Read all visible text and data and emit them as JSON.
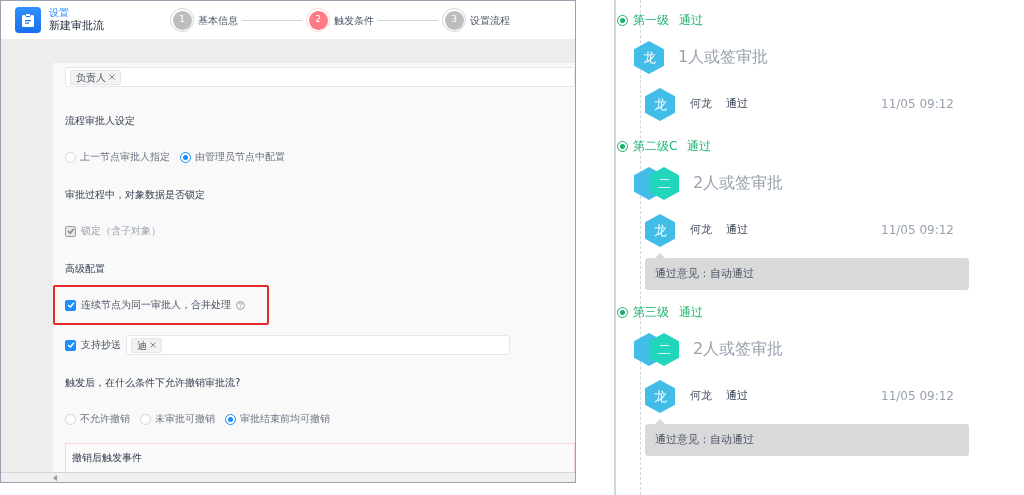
{
  "editor": {
    "breadcrumb": "设置",
    "title": "新建审批流",
    "steps": [
      {
        "number": "1",
        "label": "基本信息",
        "selected": false
      },
      {
        "number": "2",
        "label": "触发条件",
        "selected": true
      },
      {
        "number": "3",
        "label": "设置流程",
        "selected": false
      }
    ],
    "form": [
      {
        "kind": "tag_field",
        "tags": [
          "负责人"
        ]
      },
      {
        "kind": "label",
        "text": "流程审批人设定"
      },
      {
        "kind": "radio_group",
        "options": [
          {
            "label": "上一节点审批人指定",
            "selected": false
          },
          {
            "label": "由管理员节点中配置",
            "selected": true
          }
        ]
      },
      {
        "kind": "label",
        "text": "审批过程中，对象数据是否锁定"
      },
      {
        "kind": "checkbox",
        "label": "锁定（含子对象）",
        "checked": true,
        "disabled": true,
        "highlighted": false,
        "help": false
      },
      {
        "kind": "label",
        "text": "高级配置"
      },
      {
        "kind": "checkbox",
        "label": "连续节点为同一审批人，合并处理",
        "checked": true,
        "disabled": false,
        "highlighted": true,
        "help": true
      },
      {
        "kind": "checkbox_field",
        "label": "支持抄送",
        "checked": true,
        "tags": [
          "迪"
        ]
      },
      {
        "kind": "label",
        "text": "触发后，在什么条件下允许撤销审批流?"
      },
      {
        "kind": "radio_group",
        "options": [
          {
            "label": "不允许撤销",
            "selected": false
          },
          {
            "label": "未审批可撤销",
            "selected": false
          },
          {
            "label": "审批结束前均可撤销",
            "selected": true
          }
        ]
      },
      {
        "kind": "event_box",
        "text": "撤销后触发事件"
      }
    ]
  },
  "timeline": [
    {
      "title": "第一级",
      "status": "通过",
      "summary": "1人或签审批",
      "avatars": [
        {
          "text": "龙",
          "color": "#42bde8"
        }
      ],
      "approvals": [
        {
          "avatar": "龙",
          "name": "何龙",
          "status": "通过",
          "time": "11/05 09:12"
        }
      ]
    },
    {
      "title": "第二级C",
      "status": "通过",
      "summary": "2人或签审批",
      "avatars": [
        {
          "color": "#42bde8"
        },
        {
          "text": "二",
          "color": "#22d6bc"
        }
      ],
      "approvals": [
        {
          "avatar": "龙",
          "name": "何龙",
          "status": "通过",
          "time": "11/05 09:12",
          "comment": "通过意见：自动通过"
        }
      ]
    },
    {
      "title": "第三级",
      "status": "通过",
      "summary": "2人或签审批",
      "avatars": [
        {
          "color": "#42bde8"
        },
        {
          "text": "二",
          "color": "#22d6bc"
        }
      ],
      "approvals": [
        {
          "avatar": "龙",
          "name": "何龙",
          "status": "通过",
          "time": "11/05 09:12",
          "comment": "通过意见：自动通过"
        }
      ]
    }
  ]
}
